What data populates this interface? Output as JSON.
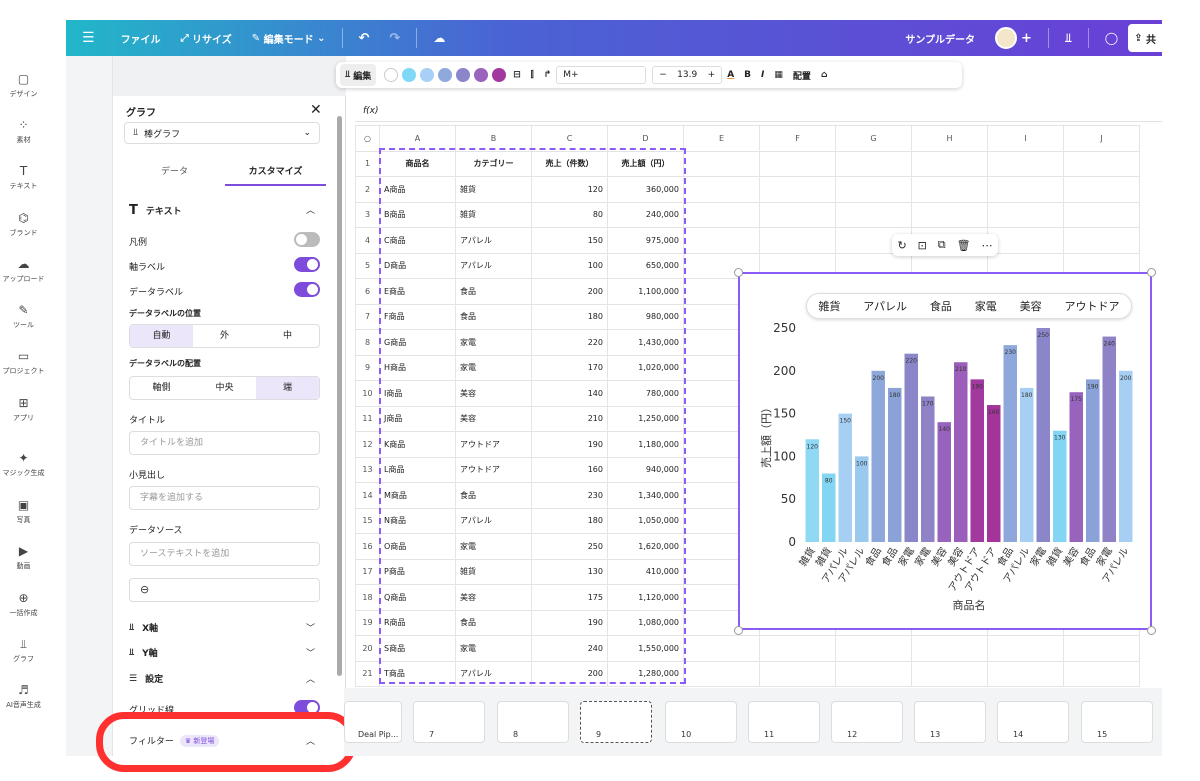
{
  "topbar": {
    "menu": "☰",
    "file": "ファイル",
    "resize": "リサイズ",
    "edit_mode": "編集モード",
    "title": "サンプルデータ",
    "share": "共"
  },
  "rail": [
    {
      "label": "デザイン",
      "icon": "design-icon"
    },
    {
      "label": "素材",
      "icon": "elements-icon"
    },
    {
      "label": "テキスト",
      "icon": "text-icon"
    },
    {
      "label": "ブランド",
      "icon": "brand-icon"
    },
    {
      "label": "アップロード",
      "icon": "upload-icon"
    },
    {
      "label": "ツール",
      "icon": "tools-icon"
    },
    {
      "label": "プロジェクト",
      "icon": "folder-icon"
    },
    {
      "label": "アプリ",
      "icon": "apps-icon"
    },
    {
      "label": "マジック生成",
      "icon": "magic-icon"
    },
    {
      "label": "写真",
      "icon": "photo-icon"
    },
    {
      "label": "動画",
      "icon": "video-icon"
    },
    {
      "label": "一括作成",
      "icon": "bulk-icon"
    },
    {
      "label": "グラフ",
      "icon": "chart-icon"
    },
    {
      "label": "AI音声生成",
      "icon": "ai-voice-icon"
    }
  ],
  "panel": {
    "title": "グラフ",
    "chart_type": "棒グラフ",
    "tab_data": "データ",
    "tab_custom": "カスタマイズ",
    "text_section": "テキスト",
    "legend": "凡例",
    "axis_label": "軸ラベル",
    "data_label": "データラベル",
    "label_pos": "データラベルの位置",
    "pos_auto": "自動",
    "pos_out": "外",
    "pos_mid": "中",
    "label_align": "データラベルの配置",
    "al_axis": "軸側",
    "al_center": "中央",
    "al_end": "端",
    "title_label": "タイトル",
    "title_ph": "タイトルを追加",
    "subtitle_label": "小見出し",
    "subtitle_ph": "字幕を追加する",
    "source_label": "データソース",
    "source_ph": "ソーステキストを追加",
    "x_axis": "X軸",
    "y_axis": "Y軸",
    "settings": "設定",
    "gridlines": "グリッド線",
    "filter": "フィルター",
    "new_badge": "新登場"
  },
  "toolbar": {
    "edit": "編集",
    "font": "M+",
    "font_size": "13.9",
    "arrange": "配置",
    "colors": [
      "#ffffff",
      "#7fd8f5",
      "#a8cff5",
      "#8fa9dc",
      "#8b85c9",
      "#9a63bd",
      "#a2399e"
    ]
  },
  "sheet": {
    "fx": "f(x)",
    "col_headers": [
      "A",
      "B",
      "C",
      "D",
      "E",
      "F",
      "G",
      "H",
      "I",
      "J"
    ],
    "header": [
      "商品名",
      "カテゴリー",
      "売上（件数）",
      "売上額（円）"
    ],
    "rows": [
      [
        "A商品",
        "雑貨",
        "120",
        "360,000"
      ],
      [
        "B商品",
        "雑貨",
        "80",
        "240,000"
      ],
      [
        "C商品",
        "アパレル",
        "150",
        "975,000"
      ],
      [
        "D商品",
        "アパレル",
        "100",
        "650,000"
      ],
      [
        "E商品",
        "食品",
        "200",
        "1,100,000"
      ],
      [
        "F商品",
        "食品",
        "180",
        "980,000"
      ],
      [
        "G商品",
        "家電",
        "220",
        "1,430,000"
      ],
      [
        "H商品",
        "家電",
        "170",
        "1,020,000"
      ],
      [
        "I商品",
        "美容",
        "140",
        "780,000"
      ],
      [
        "J商品",
        "美容",
        "210",
        "1,250,000"
      ],
      [
        "K商品",
        "アウトドア",
        "190",
        "1,180,000"
      ],
      [
        "L商品",
        "アウトドア",
        "160",
        "940,000"
      ],
      [
        "M商品",
        "食品",
        "230",
        "1,340,000"
      ],
      [
        "N商品",
        "アパレル",
        "180",
        "1,050,000"
      ],
      [
        "O商品",
        "家電",
        "250",
        "1,620,000"
      ],
      [
        "P商品",
        "雑貨",
        "130",
        "410,000"
      ],
      [
        "Q商品",
        "美容",
        "175",
        "1,120,000"
      ],
      [
        "R商品",
        "食品",
        "190",
        "1,080,000"
      ],
      [
        "S商品",
        "家電",
        "240",
        "1,550,000"
      ],
      [
        "T商品",
        "アパレル",
        "200",
        "1,280,000"
      ]
    ]
  },
  "chart_data": {
    "type": "bar",
    "categories": [
      "雑貨",
      "雑貨",
      "アパレル",
      "アパレル",
      "食品",
      "食品",
      "家電",
      "家電",
      "美容",
      "美容",
      "アウトドア",
      "アウトドア",
      "食品",
      "アパレル",
      "家電",
      "雑貨",
      "美容",
      "食品",
      "家電",
      "アパレル"
    ],
    "values": [
      120,
      80,
      150,
      100,
      200,
      180,
      220,
      170,
      140,
      210,
      190,
      160,
      230,
      180,
      250,
      130,
      175,
      190,
      240,
      200
    ],
    "colors": [
      "#8fd9f5",
      "#83d5f4",
      "#a7cff4",
      "#99c9ef",
      "#8fa8dc",
      "#8aa2d8",
      "#8b86c9",
      "#8f82c6",
      "#9863bd",
      "#9c5ebb",
      "#a2399e",
      "#a5349a",
      "#8fa8dc",
      "#a7cff4",
      "#8b86c9",
      "#83d5f4",
      "#9863bd",
      "#8aa2d8",
      "#8f82c6",
      "#a7cff4"
    ],
    "legend": [
      "雑貨",
      "アパレル",
      "食品",
      "家電",
      "美容",
      "アウトドア"
    ],
    "ylabel": "売上額（円）",
    "xlabel": "商品名",
    "yticks": [
      "0",
      "50",
      "100",
      "150",
      "200",
      "250"
    ],
    "ylim": [
      0,
      250
    ]
  },
  "pages": [
    {
      "label": "Deal Pip..."
    },
    {
      "label": "7"
    },
    {
      "label": "8"
    },
    {
      "label": "9"
    },
    {
      "label": "10"
    },
    {
      "label": "11"
    },
    {
      "label": "12"
    },
    {
      "label": "13"
    },
    {
      "label": "14"
    },
    {
      "label": "15"
    }
  ]
}
